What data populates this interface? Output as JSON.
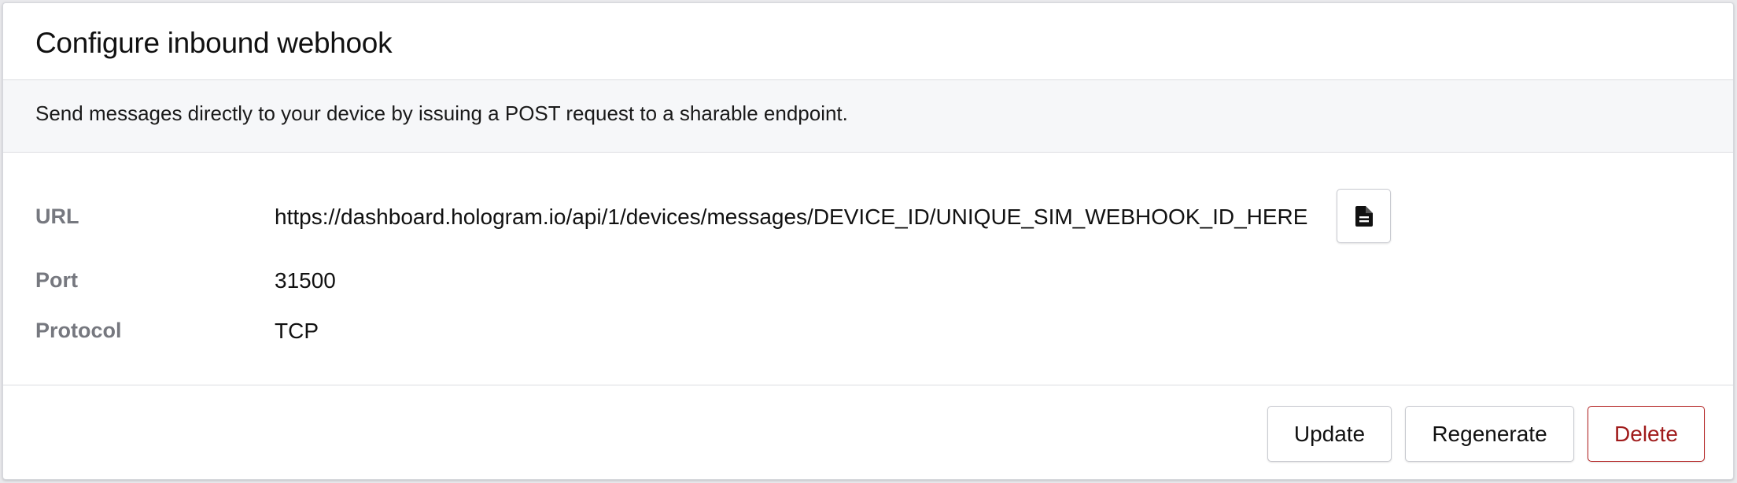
{
  "card": {
    "title": "Configure inbound webhook",
    "description": "Send messages directly to your device by issuing a POST request to a sharable endpoint."
  },
  "fields": {
    "url": {
      "label": "URL",
      "value": "https://dashboard.hologram.io/api/1/devices/messages/DEVICE_ID/UNIQUE_SIM_WEBHOOK_ID_HERE"
    },
    "port": {
      "label": "Port",
      "value": "31500"
    },
    "protocol": {
      "label": "Protocol",
      "value": "TCP"
    }
  },
  "copy_button": {
    "icon": "document-icon"
  },
  "actions": {
    "update_label": "Update",
    "regenerate_label": "Regenerate",
    "delete_label": "Delete"
  },
  "colors": {
    "delete": "#a01b1b",
    "label_gray": "#76787f",
    "description_bg": "#f6f7f9"
  }
}
